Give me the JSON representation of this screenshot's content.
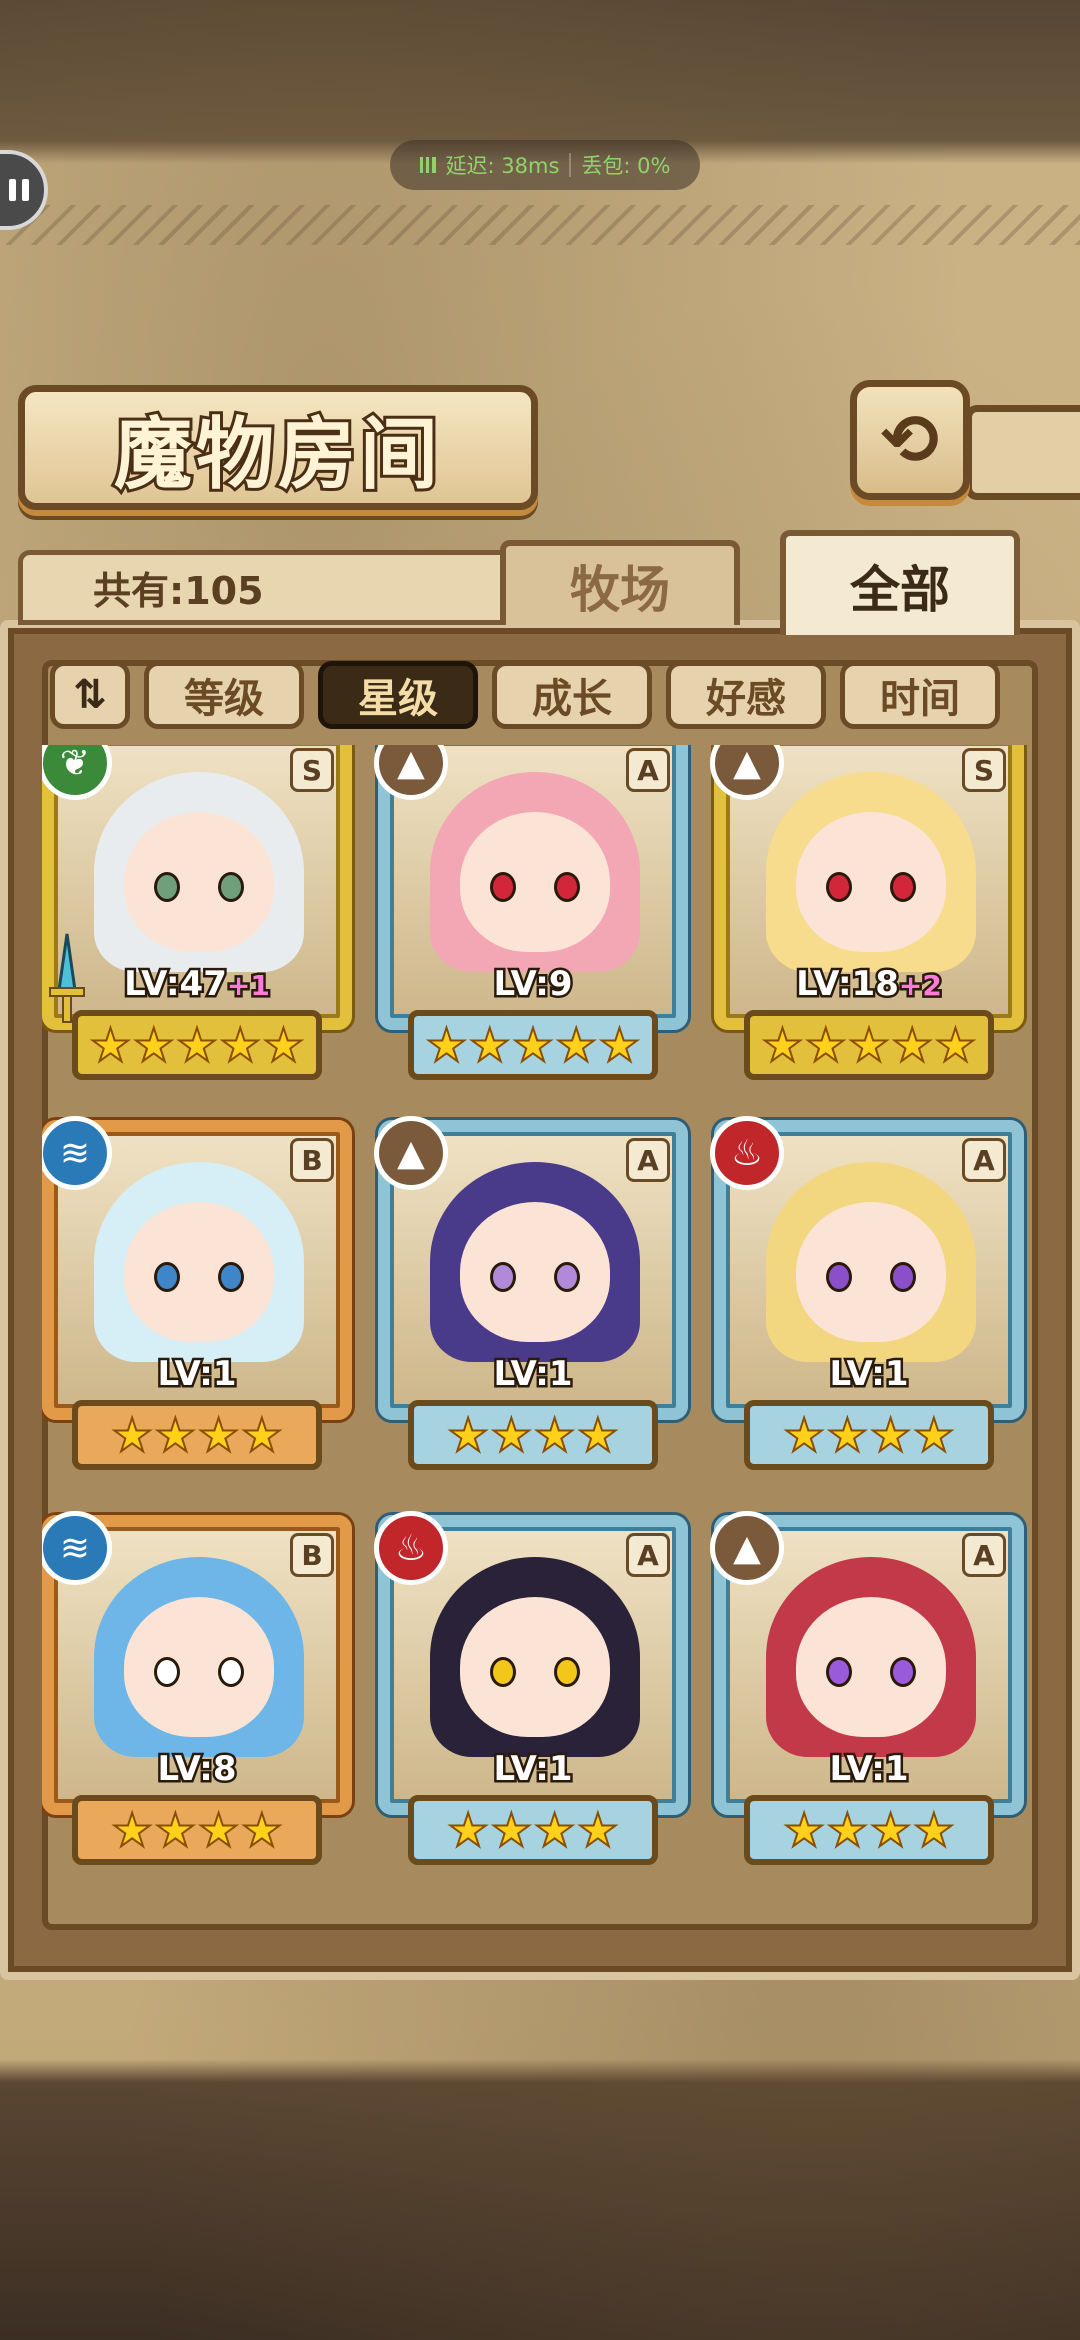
{
  "network": {
    "latency": "延迟: 38ms",
    "packet_loss": "丢包: 0%"
  },
  "title": "魔物房间",
  "back_label": "⟲",
  "count_label": "共有:105",
  "tabs": [
    {
      "label": "牧场",
      "active": false
    },
    {
      "label": "全部",
      "active": true
    }
  ],
  "sort_toggle_label": "⇅",
  "filters": [
    {
      "label": "等级",
      "active": false
    },
    {
      "label": "星级",
      "active": true
    },
    {
      "label": "成长",
      "active": false
    },
    {
      "label": "好感",
      "active": false
    },
    {
      "label": "时间",
      "active": false
    }
  ],
  "cards": [
    {
      "rank": "S",
      "element": "nature",
      "element_color": "#3a8a3a",
      "element_glyph": "❦",
      "level": "LV:47",
      "bonus": "+1",
      "stars": 5,
      "hair": "#e9ecef",
      "eyes": "#6fa07a",
      "has_weapon": true
    },
    {
      "rank": "A",
      "element": "earth",
      "element_color": "#7a5a3a",
      "element_glyph": "▲",
      "level": "LV:9",
      "bonus": "",
      "stars": 5,
      "hair": "#f3a6b4",
      "eyes": "#d2263a",
      "has_weapon": false
    },
    {
      "rank": "S",
      "element": "earth",
      "element_color": "#7a5a3a",
      "element_glyph": "▲",
      "level": "LV:18",
      "bonus": "+2",
      "stars": 5,
      "hair": "#f6dc8c",
      "eyes": "#d2263a",
      "has_weapon": false
    },
    {
      "rank": "B",
      "element": "water",
      "element_color": "#2a7ab8",
      "element_glyph": "≋",
      "level": "LV:1",
      "bonus": "",
      "stars": 4,
      "hair": "#d6eef5",
      "eyes": "#3f86c9",
      "has_weapon": false
    },
    {
      "rank": "A",
      "element": "earth",
      "element_color": "#7a5a3a",
      "element_glyph": "▲",
      "level": "LV:1",
      "bonus": "",
      "stars": 4,
      "hair": "#4a3a8a",
      "eyes": "#b08ad9",
      "has_weapon": false
    },
    {
      "rank": "A",
      "element": "fire",
      "element_color": "#c0262a",
      "element_glyph": "♨",
      "level": "LV:1",
      "bonus": "",
      "stars": 4,
      "hair": "#f3d680",
      "eyes": "#8a4fc9",
      "has_weapon": false
    },
    {
      "rank": "B",
      "element": "water",
      "element_color": "#2a7ab8",
      "element_glyph": "≋",
      "level": "LV:8",
      "bonus": "",
      "stars": 4,
      "hair": "#6fb6e8",
      "eyes": "#ffffff",
      "has_weapon": false
    },
    {
      "rank": "A",
      "element": "fire",
      "element_color": "#c0262a",
      "element_glyph": "♨",
      "level": "LV:1",
      "bonus": "",
      "stars": 4,
      "hair": "#2a2238",
      "eyes": "#f3c61a",
      "has_weapon": false
    },
    {
      "rank": "A",
      "element": "earth",
      "element_color": "#7a5a3a",
      "element_glyph": "▲",
      "level": "LV:1",
      "bonus": "",
      "stars": 4,
      "hair": "#c23a4a",
      "eyes": "#9a5ad9",
      "has_weapon": false
    }
  ]
}
